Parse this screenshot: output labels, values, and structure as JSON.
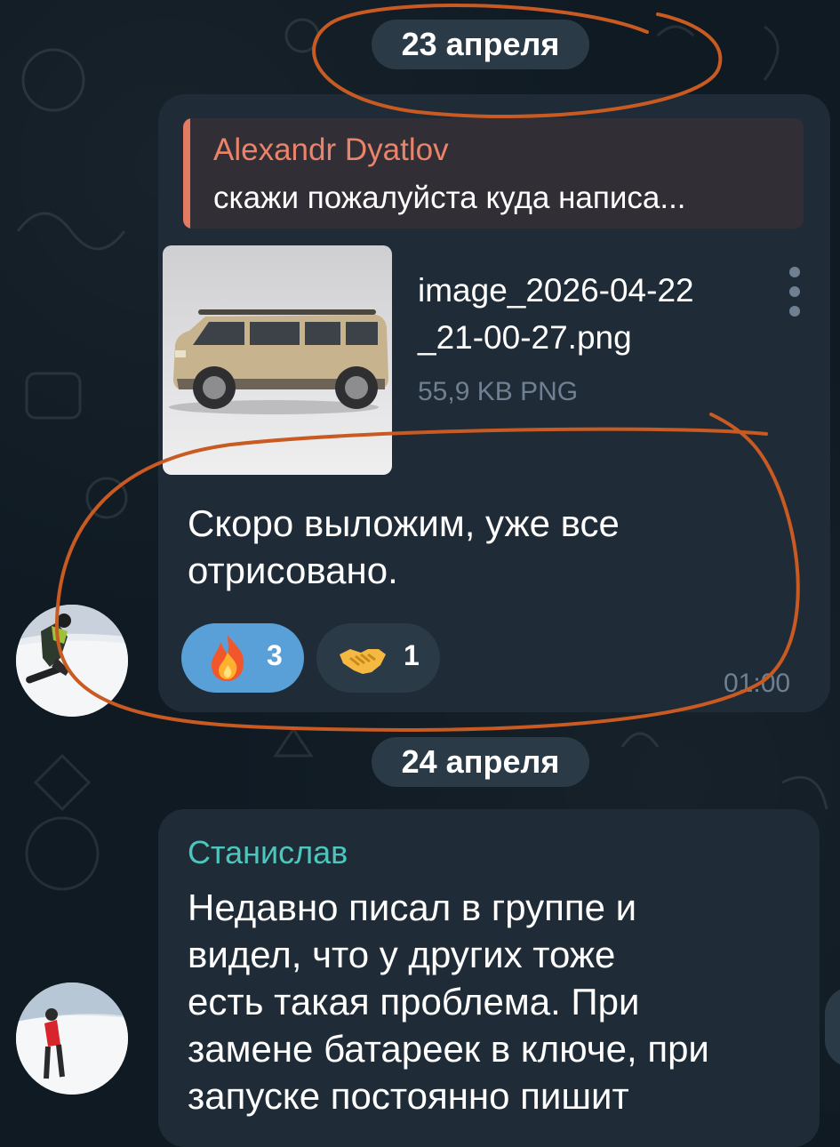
{
  "chat": {
    "date_separators": [
      "23 апреля",
      "24 апреля"
    ]
  },
  "message_1": {
    "reply": {
      "author": "Alexandr Dyatlov",
      "text": "скажи пожалуйста куда написа..."
    },
    "attachment": {
      "file_name_line1": "image_2026-04-22",
      "file_name_line2": "_21-00-27.png",
      "meta": "55,9 KB PNG"
    },
    "text_line1": "Скоро выложим, уже все",
    "text_line2": "отрисовано.",
    "reactions": [
      {
        "emoji": "fire-emoji",
        "count": "3",
        "selected": true
      },
      {
        "emoji": "handshake-emoji",
        "count": "1",
        "selected": false
      }
    ],
    "time": "01:00"
  },
  "message_2": {
    "author": "Станислав",
    "lines": [
      "Недавно писал в группе и",
      "видел, что у других тоже",
      "есть такая проблема. При",
      "замене батареек в ключе, при",
      "запуске постоянно пишит"
    ]
  },
  "colors": {
    "background": "#0f1a23",
    "bubble": "#1f2c37",
    "date_pill": "#2a3a47",
    "reply_accent": "#e27b62",
    "sender_name": "#4ec6bd",
    "reaction_selected": "#5aa0d8",
    "annotation_stroke": "#c85a22"
  }
}
